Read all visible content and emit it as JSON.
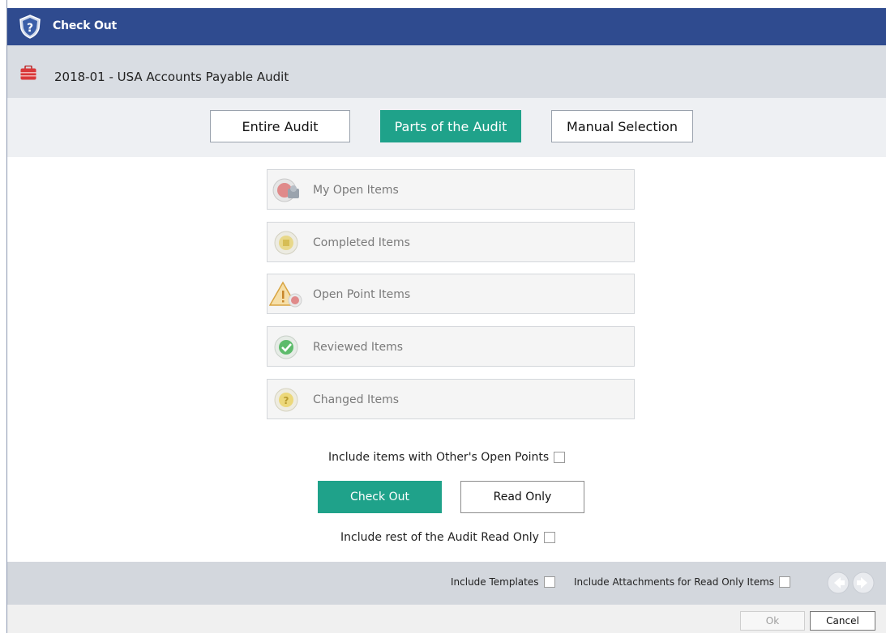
{
  "window": {
    "title": "Check Out",
    "title_icon": "help-shield-icon"
  },
  "audit": {
    "name": "2018-01 - USA Accounts Payable Audit",
    "icon": "briefcase-icon"
  },
  "mode_tabs": [
    {
      "label": "Entire Audit",
      "active": false
    },
    {
      "label": "Parts of the Audit",
      "active": true
    },
    {
      "label": "Manual Selection",
      "active": false
    }
  ],
  "item_filters": [
    {
      "label": "My Open Items",
      "icon": "my-open-items-icon",
      "enabled": false
    },
    {
      "label": "Completed Items",
      "icon": "completed-items-icon",
      "enabled": false
    },
    {
      "label": "Open Point Items",
      "icon": "open-point-warning-icon",
      "enabled": false
    },
    {
      "label": "Reviewed Items",
      "icon": "reviewed-check-icon",
      "enabled": false
    },
    {
      "label": "Changed Items",
      "icon": "changed-items-icon",
      "enabled": false
    }
  ],
  "options": {
    "include_others_open_points": {
      "label": "Include items with Other's Open Points",
      "checked": false
    },
    "include_rest_read_only": {
      "label": "Include rest of the Audit Read Only",
      "checked": false
    }
  },
  "actions": {
    "check_out": "Check Out",
    "read_only": "Read Only"
  },
  "footer": {
    "include_templates": {
      "label": "Include Templates",
      "checked": false
    },
    "include_attachments": {
      "label": "Include Attachments for Read Only Items",
      "checked": false
    }
  },
  "dialog_buttons": {
    "ok": "Ok",
    "cancel": "Cancel"
  },
  "colors": {
    "title_bar": "#2f4b8f",
    "accent": "#1fa28a"
  }
}
